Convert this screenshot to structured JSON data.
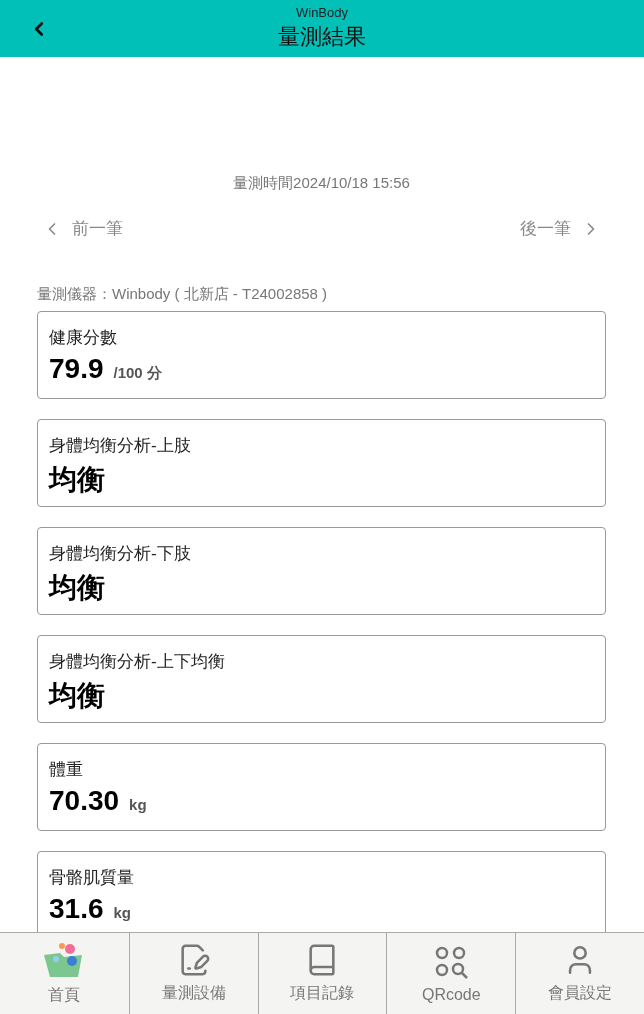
{
  "header": {
    "app_name": "WinBody",
    "title": "量測結果"
  },
  "measured_at": "量測時間2024/10/18 15:56",
  "nav": {
    "previous": "前一筆",
    "next": "後一筆"
  },
  "device": "量測儀器：Winbody ( 北新店 - T24002858 )",
  "cards": [
    {
      "label": "健康分數",
      "value": "79.9",
      "unit": "/100 分"
    },
    {
      "label": "身體均衡分析-上肢",
      "value": "均衡"
    },
    {
      "label": "身體均衡分析-下肢",
      "value": "均衡"
    },
    {
      "label": "身體均衡分析-上下均衡",
      "value": "均衡"
    },
    {
      "label": "體重",
      "value": "70.30",
      "unit": "kg"
    },
    {
      "label": "骨骼肌質量",
      "value": "31.6",
      "unit": "kg"
    }
  ],
  "tab_bar": [
    {
      "label": "首頁",
      "kind": "home"
    },
    {
      "label": "量測設備",
      "kind": "device"
    },
    {
      "label": "項目記錄",
      "kind": "records"
    },
    {
      "label": "QRcode",
      "kind": "qr"
    },
    {
      "label": "會員設定",
      "kind": "member"
    }
  ]
}
